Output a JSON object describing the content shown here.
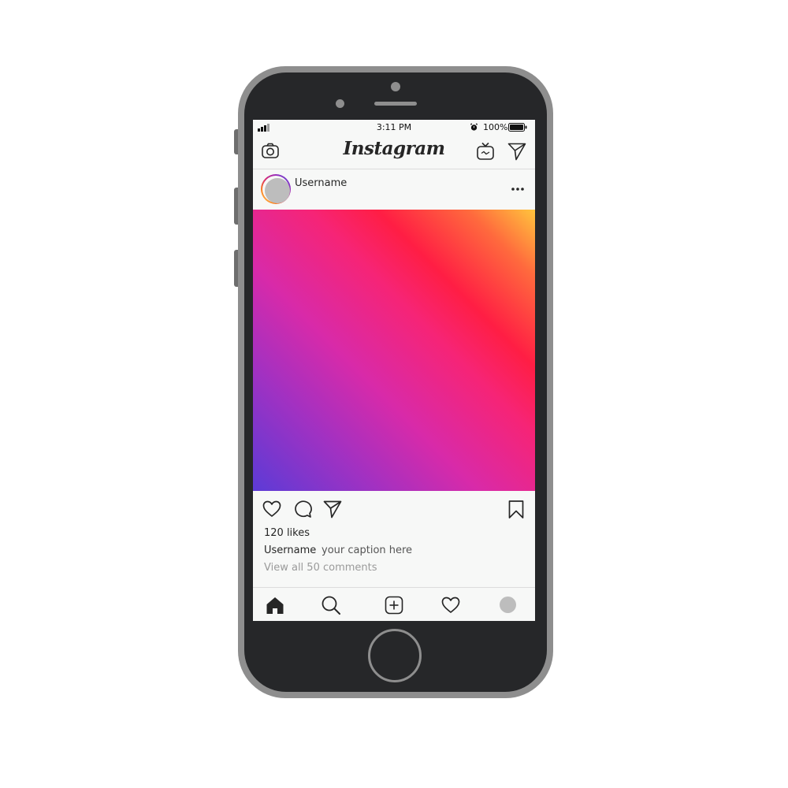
{
  "status_bar": {
    "time": "3:11 PM",
    "battery": "100%"
  },
  "header": {
    "logo": "Instagram",
    "icons": [
      "camera-icon",
      "igtv-icon",
      "direct-message-icon"
    ]
  },
  "post": {
    "username": "Username",
    "likes": "120 likes",
    "caption_user": "Username",
    "caption": "your caption here",
    "view_comments": "View all 50 comments",
    "gradient_colors": [
      "#5c3bd6",
      "#d82aa9",
      "#ff1e44",
      "#ffc53d"
    ],
    "actions": [
      "heart-icon",
      "comment-icon",
      "share-icon",
      "bookmark-icon"
    ]
  },
  "bottom_nav": {
    "items": [
      "home-icon",
      "search-icon",
      "add-post-icon",
      "activity-heart-icon",
      "profile-avatar"
    ]
  },
  "colors": {
    "device_frame": "#8e8e8e",
    "device_body": "#262729",
    "screen_bg": "#f7f8f7",
    "text": "#262626"
  }
}
